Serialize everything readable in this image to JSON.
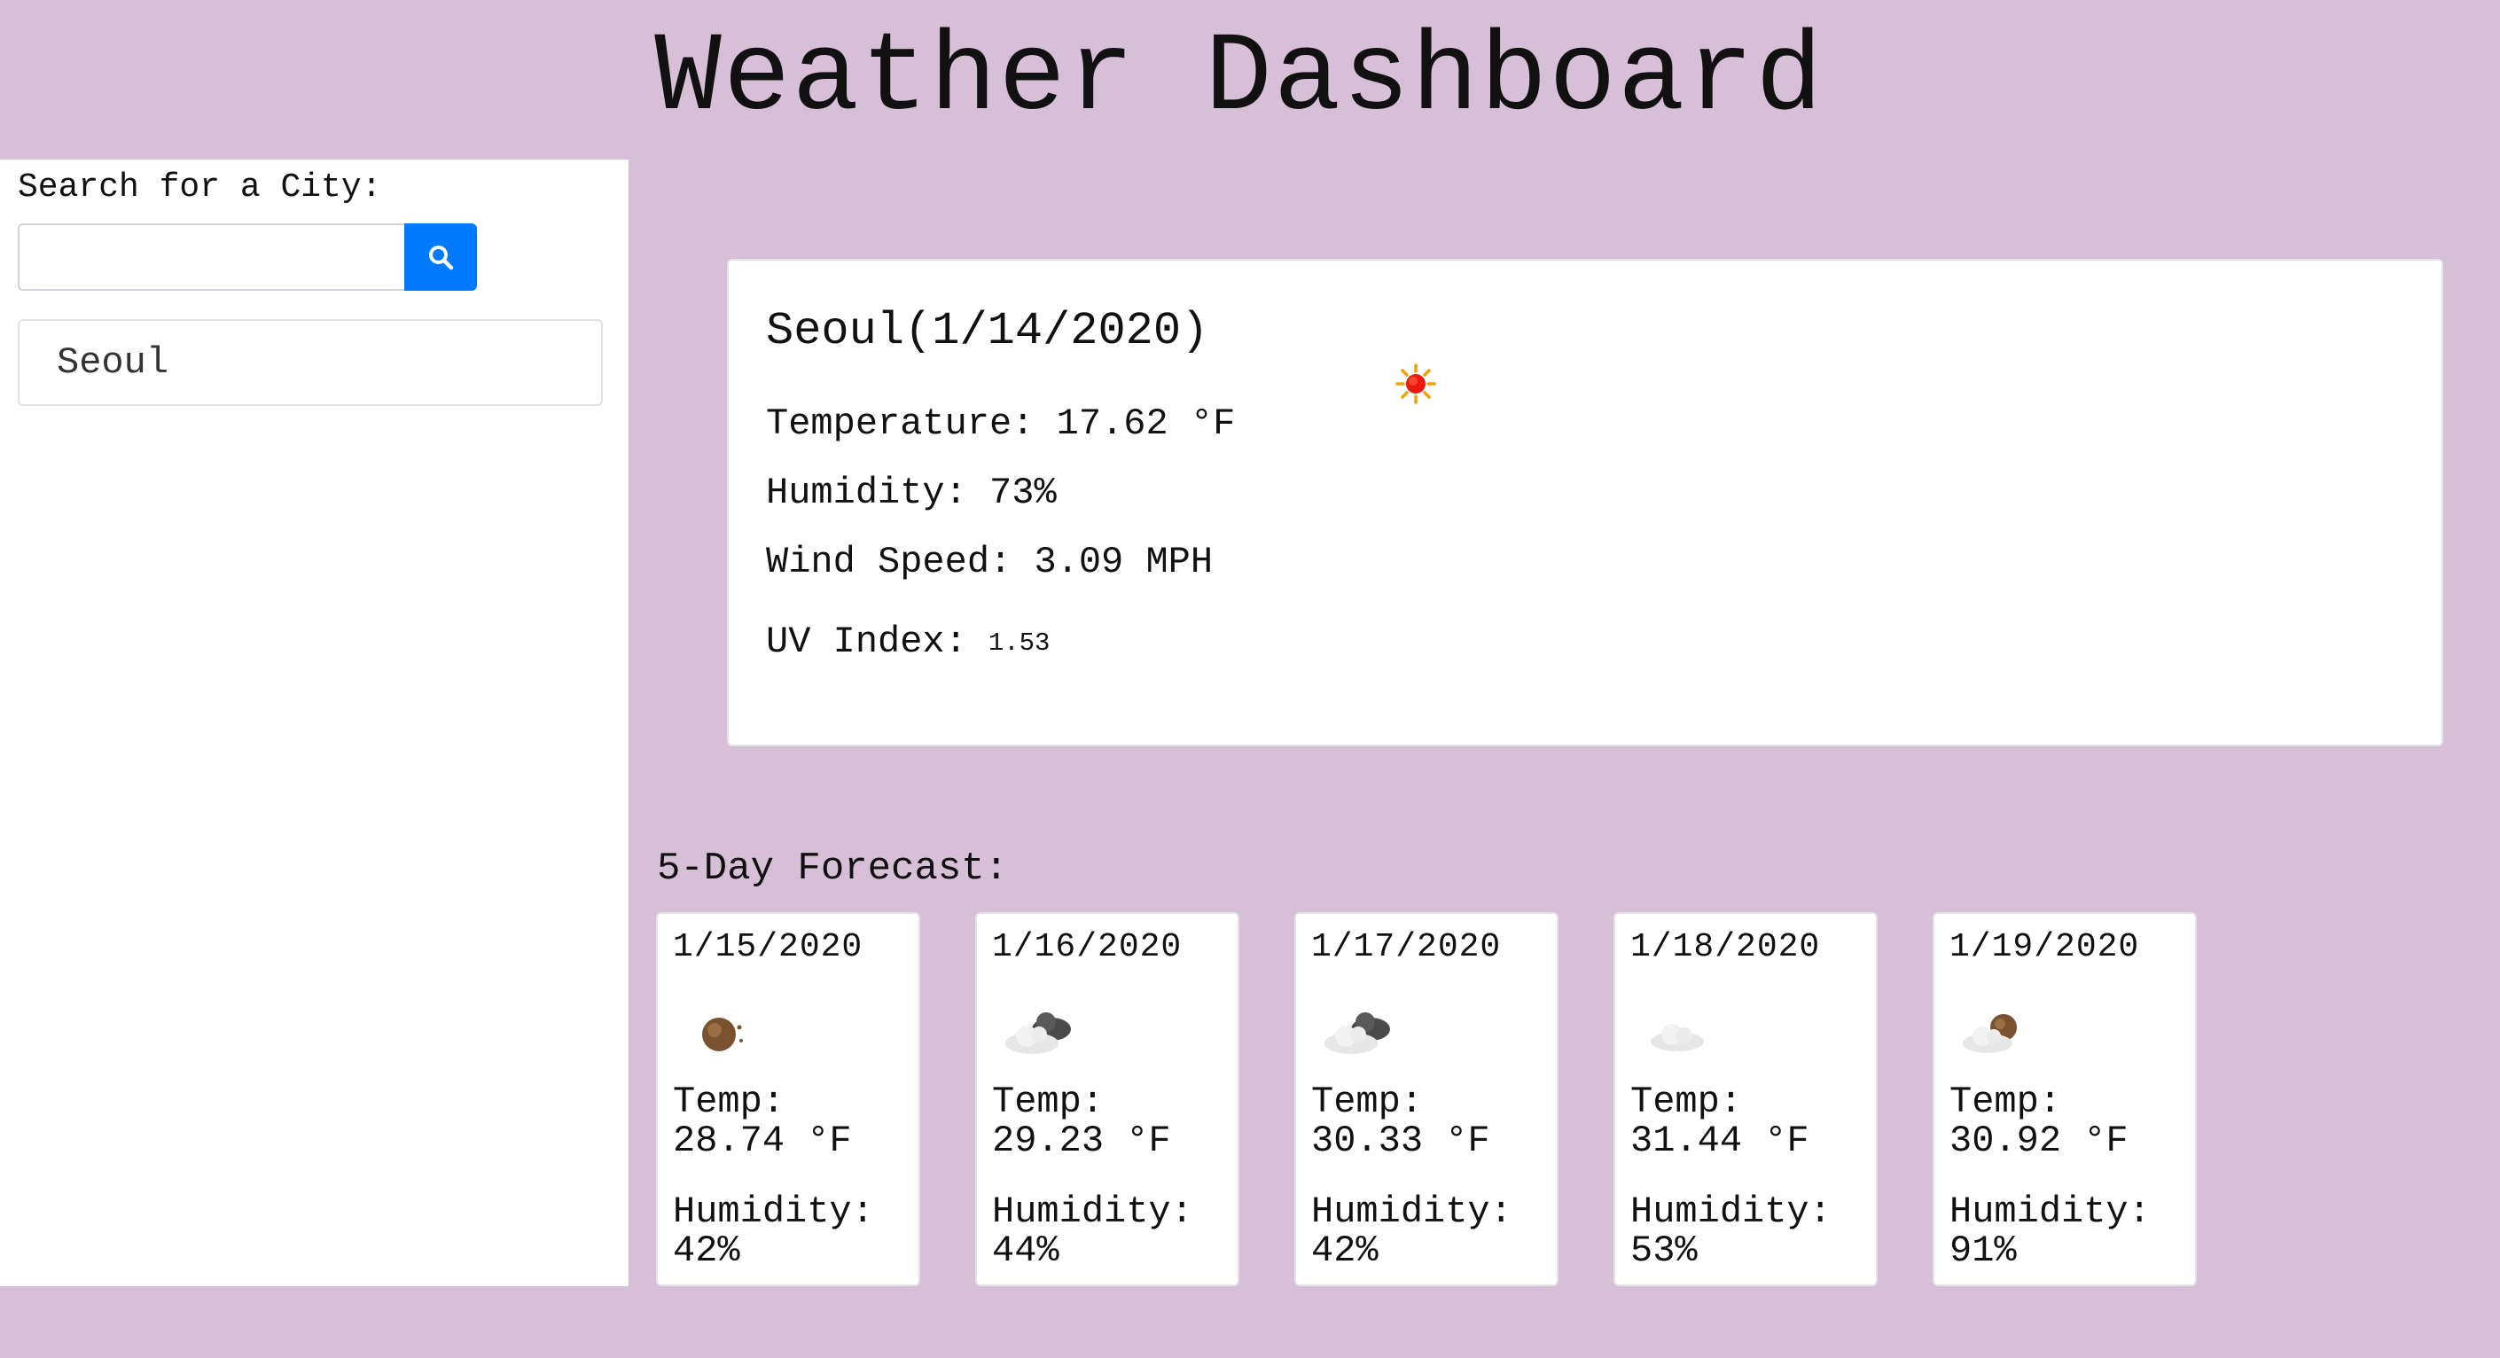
{
  "header": {
    "title": "Weather Dashboard"
  },
  "sidebar": {
    "search_label": "Search for a City:",
    "search_input": {
      "value": "",
      "placeholder": ""
    },
    "search_button_icon": "search-icon",
    "cities": [
      {
        "label": "Seoul"
      }
    ]
  },
  "current": {
    "city": "Seoul",
    "date": "(1/14/2020)",
    "icon": "sun-icon",
    "temperature": "Temperature: 17.62 °F",
    "humidity": "Humidity: 73%",
    "wind": "Wind Speed: 3.09 MPH",
    "uv_label": "UV Index:",
    "uv_value": "1.53"
  },
  "forecast": {
    "title": "5-Day Forecast:",
    "days": [
      {
        "date": "1/15/2020",
        "icon": "clear-night-icon",
        "temp_label": "Temp:",
        "temp": "28.74 °F",
        "humidity_label": "Humidity:",
        "humidity": "42%"
      },
      {
        "date": "1/16/2020",
        "icon": "broken-clouds-icon",
        "temp_label": "Temp:",
        "temp": "29.23 °F",
        "humidity_label": "Humidity:",
        "humidity": "44%"
      },
      {
        "date": "1/17/2020",
        "icon": "broken-clouds-icon",
        "temp_label": "Temp:",
        "temp": "30.33 °F",
        "humidity_label": "Humidity:",
        "humidity": "42%"
      },
      {
        "date": "1/18/2020",
        "icon": "cloud-icon",
        "temp_label": "Temp:",
        "temp": "31.44 °F",
        "humidity_label": "Humidity:",
        "humidity": "53%"
      },
      {
        "date": "1/19/2020",
        "icon": "partly-cloudy-night-icon",
        "temp_label": "Temp:",
        "temp": "30.92 °F",
        "humidity_label": "Humidity:",
        "humidity": "91%"
      }
    ]
  },
  "colors": {
    "background": "#d8bfd8",
    "accent": "#007bff"
  }
}
